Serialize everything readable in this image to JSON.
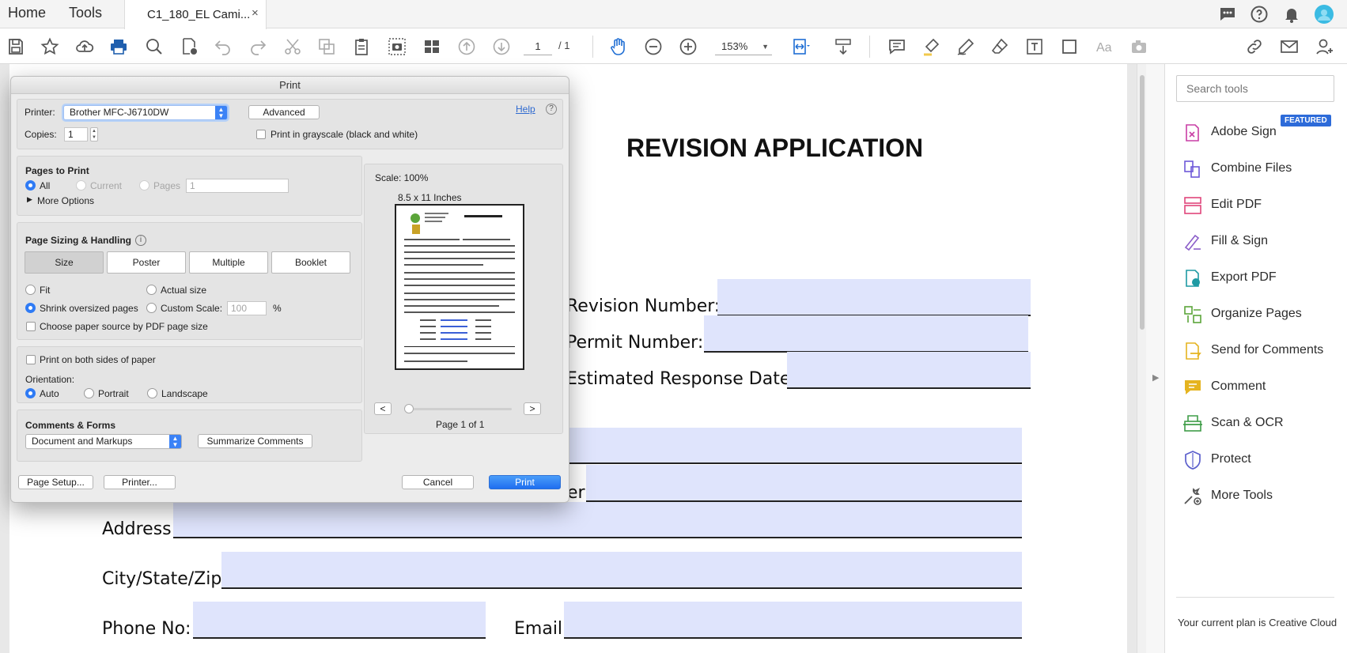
{
  "topbar": {
    "home": "Home",
    "tools": "Tools",
    "doc_tab": "C1_180_EL Cami...",
    "tab_close": "×"
  },
  "toolbar": {
    "page_current": "1",
    "page_total": "/ 1",
    "zoom": "153%"
  },
  "document": {
    "title": "REVISION APPLICATION",
    "revision_number_label": "Revision Number:",
    "permit_number_label": "Permit Number:",
    "estimated_response_label": "Estimated Response Date:",
    "partial_label": "er",
    "address_label": "Address:",
    "city_label": "City/State/Zip",
    "phone_label": "Phone No:",
    "email_label": "Email:"
  },
  "right_panel": {
    "search_placeholder": "Search tools",
    "featured_badge": "FEATURED",
    "tools": [
      {
        "label": "Adobe Sign",
        "icon": "adobe-sign-icon",
        "color": "#c93fa5"
      },
      {
        "label": "Combine Files",
        "icon": "combine-files-icon",
        "color": "#6e59d9"
      },
      {
        "label": "Edit PDF",
        "icon": "edit-pdf-icon",
        "color": "#e0457b"
      },
      {
        "label": "Fill & Sign",
        "icon": "fill-sign-icon",
        "color": "#8b5ec9"
      },
      {
        "label": "Export PDF",
        "icon": "export-pdf-icon",
        "color": "#1e9aa3"
      },
      {
        "label": "Organize Pages",
        "icon": "organize-pages-icon",
        "color": "#5ba53a"
      },
      {
        "label": "Send for Comments",
        "icon": "send-comments-icon",
        "color": "#e5b420"
      },
      {
        "label": "Comment",
        "icon": "comment-icon",
        "color": "#e5b420"
      },
      {
        "label": "Scan & OCR",
        "icon": "scan-ocr-icon",
        "color": "#3f9d48"
      },
      {
        "label": "Protect",
        "icon": "protect-icon",
        "color": "#5b5fcc"
      },
      {
        "label": "More Tools",
        "icon": "more-tools-icon",
        "color": "#555555"
      }
    ],
    "plan_text": "Your current plan is Creative Cloud"
  },
  "print_dialog": {
    "title": "Print",
    "printer_label": "Printer:",
    "printer_value": "Brother MFC-J6710DW",
    "advanced": "Advanced",
    "help": "Help",
    "help_icon": "?",
    "copies_label": "Copies:",
    "copies_value": "1",
    "grayscale": "Print in grayscale (black and white)",
    "pages_to_print": {
      "heading": "Pages to Print",
      "all": "All",
      "current": "Current",
      "pages": "Pages",
      "pages_value": "1",
      "more_options": "More Options"
    },
    "sizing": {
      "heading": "Page Sizing & Handling",
      "info_icon": "i",
      "tabs": [
        "Size",
        "Poster",
        "Multiple",
        "Booklet"
      ],
      "fit": "Fit",
      "actual_size": "Actual size",
      "shrink": "Shrink oversized pages",
      "custom_scale": "Custom Scale:",
      "custom_scale_value": "100",
      "percent": "%",
      "paper_source": "Choose paper source by PDF page size"
    },
    "both_sides": "Print on both sides of paper",
    "orientation": {
      "label": "Orientation:",
      "auto": "Auto",
      "portrait": "Portrait",
      "landscape": "Landscape"
    },
    "comments_forms": {
      "heading": "Comments & Forms",
      "value": "Document and Markups",
      "summarize": "Summarize Comments"
    },
    "preview": {
      "scale": "Scale: 100%",
      "size": "8.5 x 11 Inches",
      "prev": "<",
      "next": ">",
      "page_of": "Page 1 of 1"
    },
    "page_setup": "Page Setup...",
    "printer_btn": "Printer...",
    "cancel": "Cancel",
    "print": "Print"
  }
}
